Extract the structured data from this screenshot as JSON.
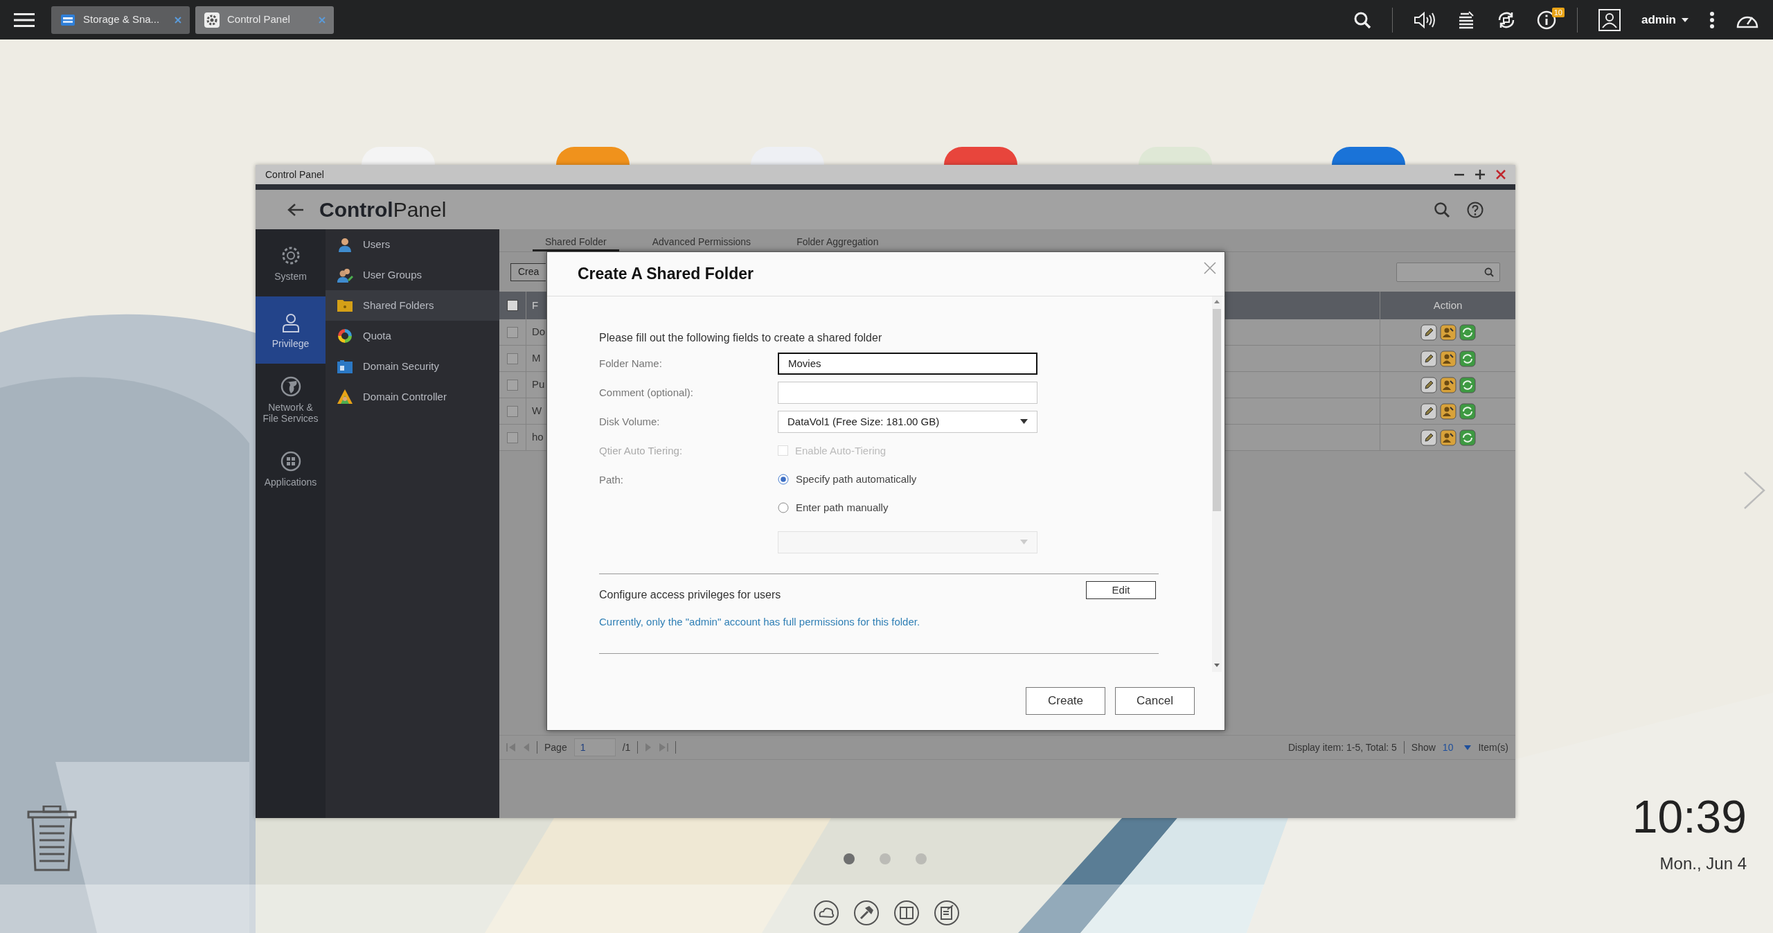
{
  "taskbar": {
    "tabs": [
      {
        "label": "Storage & Sna...",
        "selected": false
      },
      {
        "label": "Control Panel",
        "selected": true
      }
    ],
    "notification_count": "10",
    "user": "admin"
  },
  "window": {
    "title": "Control Panel",
    "heading": "**Control**Panel",
    "nav": [
      {
        "label": "System",
        "selected": false
      },
      {
        "label": "Privilege",
        "selected": true
      },
      {
        "label": "Network & File Services",
        "selected": false
      },
      {
        "label": "Applications",
        "selected": false
      }
    ],
    "subnav": [
      {
        "label": "Users",
        "selected": false
      },
      {
        "label": "User Groups",
        "selected": false
      },
      {
        "label": "Shared Folders",
        "selected": true
      },
      {
        "label": "Quota",
        "selected": false
      },
      {
        "label": "Domain Security",
        "selected": false
      },
      {
        "label": "Domain Controller",
        "selected": false
      }
    ],
    "tabs": [
      {
        "label": "Shared Folder",
        "selected": true
      },
      {
        "label": "Advanced Permissions",
        "selected": false
      },
      {
        "label": "Folder Aggregation",
        "selected": false
      }
    ],
    "toolbar_button": "Crea",
    "table": {
      "columns": [
        "F",
        "Action"
      ],
      "header_checked": false,
      "rows": [
        {
          "column_1": "Do",
          "checked": false
        },
        {
          "column_1": "M",
          "checked": false
        },
        {
          "column_1": "Pu",
          "checked": false
        },
        {
          "column_1": "W",
          "checked": false
        },
        {
          "column_1": "ho",
          "checked": false
        }
      ]
    },
    "pagination": {
      "page_label": "Page",
      "page": "1",
      "total_pages": "/1",
      "display": "Display item: 1-5, Total: 5",
      "show_label": "Show",
      "show_value": "10",
      "items_label": "Item(s)"
    }
  },
  "dialog": {
    "title": "Create A Shared Folder",
    "intro": "Please fill out the following fields to create a shared folder",
    "fields": [
      {
        "kind": "text",
        "label": "Folder Name:",
        "value": "Movies",
        "focused": true
      },
      {
        "kind": "text",
        "label": "Comment (optional):",
        "focused": false
      },
      {
        "kind": "select",
        "label": "Disk Volume:",
        "value": "DataVol1 (Free Size: 181.00 GB)",
        "disabled": false
      },
      {
        "kind": "checkbox",
        "label": "Qtier Auto Tiering:",
        "option": "Enable Auto-Tiering",
        "checked": false,
        "disabled": true
      },
      {
        "kind": "radio",
        "label": "Path:",
        "options": [
          {
            "label": "Specify path automatically",
            "selected": true
          },
          {
            "label": "Enter path manually",
            "selected": false
          }
        ]
      },
      {
        "kind": "select",
        "disabled": true
      }
    ],
    "privileges": {
      "heading": "Configure access privileges for users",
      "button": "Edit",
      "note": "Currently, only the \"admin\" account has full permissions for this folder."
    },
    "buttons": [
      "Create",
      "Cancel"
    ]
  },
  "desktop": {
    "page_dots": [
      {
        "selected": true
      },
      {
        "selected": false
      },
      {
        "selected": false
      }
    ],
    "time": "10:39",
    "date": "Mon., Jun 4"
  }
}
